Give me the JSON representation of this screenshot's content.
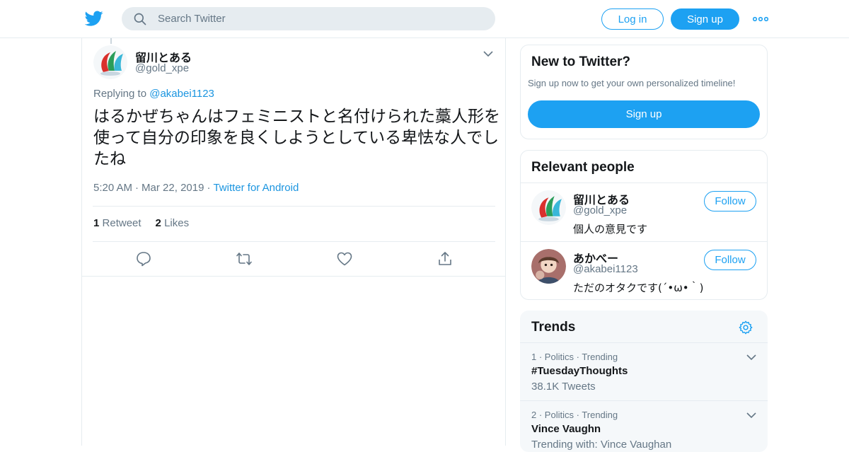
{
  "colors": {
    "brand": "#1da1f2",
    "link": "#1b95e0",
    "muted": "#657786",
    "text": "#14171a",
    "border": "#e6ecf0"
  },
  "header": {
    "logo_icon": "twitter-bird-icon",
    "search_placeholder": "Search Twitter",
    "login_label": "Log in",
    "signup_label": "Sign up",
    "more_icon": "more-dots-icon"
  },
  "tweet": {
    "author_name": "留川とある",
    "author_handle": "@gold_xpe",
    "replying_prefix": "Replying to",
    "replying_to": "@akabei1123",
    "text": "はるかぜちゃんはフェミニストと名付けられた藁人形を使って自分の印象を良くしようとしている卑怯な人でしたね",
    "time": "5:20 AM",
    "date": "Mar 22, 2019",
    "source": "Twitter for Android",
    "retweet_count": "1",
    "retweet_label": "Retweet",
    "like_count": "2",
    "like_label": "Likes"
  },
  "sidebar": {
    "new_to_twitter": {
      "title": "New to Twitter?",
      "subtitle": "Sign up now to get your own personalized timeline!",
      "signup_label": "Sign up"
    },
    "relevant_people": {
      "title": "Relevant people",
      "people": [
        {
          "name": "留川とある",
          "handle": "@gold_xpe",
          "bio": "個人の意見です",
          "follow_label": "Follow"
        },
        {
          "name": "あかべー",
          "handle": "@akabei1123",
          "bio": "ただのオタクです(´•ω•｀)",
          "follow_label": "Follow"
        }
      ]
    },
    "trends": {
      "title": "Trends",
      "items": [
        {
          "rank": "1",
          "category": "Politics",
          "status": "Trending",
          "name": "#TuesdayThoughts",
          "count": "38.1K Tweets"
        },
        {
          "rank": "2",
          "category": "Politics",
          "status": "Trending",
          "name": "Vince Vaughn",
          "count": "Trending with: Vince Vaughan"
        }
      ]
    }
  }
}
